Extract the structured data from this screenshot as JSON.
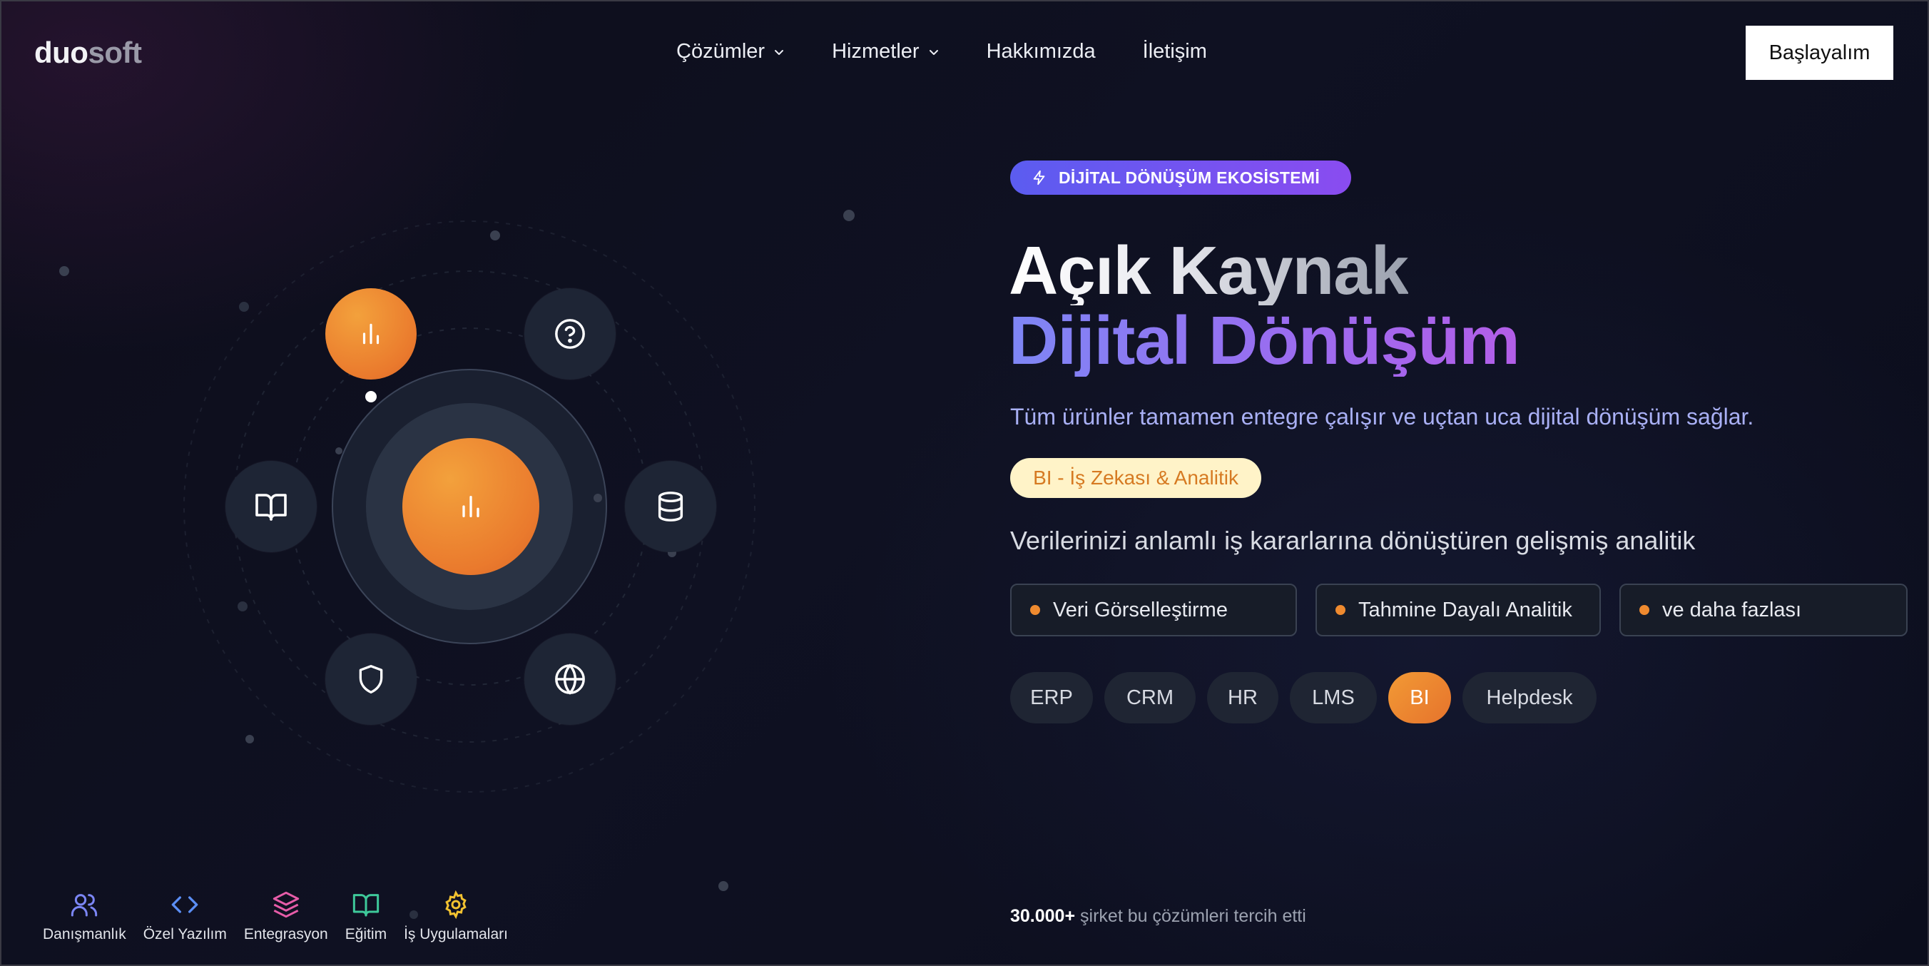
{
  "brand": {
    "logo_part1": "duo",
    "logo_part2": "soft"
  },
  "nav": {
    "items": [
      {
        "label": "Çözümler",
        "has_dropdown": true
      },
      {
        "label": "Hizmetler",
        "has_dropdown": true
      },
      {
        "label": "Hakkımızda",
        "has_dropdown": false
      },
      {
        "label": "İletişim",
        "has_dropdown": false
      }
    ],
    "cta_label": "Başlayalım"
  },
  "orbit": {
    "center_icon": "bar-chart-icon",
    "nodes": [
      "bar-chart-icon",
      "help-circle-icon",
      "book-icon",
      "database-icon",
      "shield-icon",
      "globe-icon"
    ],
    "active_node": "bar-chart-icon"
  },
  "hero": {
    "badge": "DİJİTAL DÖNÜŞÜM EKOSİSTEMİ",
    "title_line1": "Açık Kaynak",
    "title_line2": "Dijital Dönüşüm",
    "subtitle": "Tüm ürünler tamamen entegre çalışır ve uçtan uca dijital dönüşüm sağlar.",
    "product_pill": "BI - İş Zekası & Analitik",
    "description": "Verilerinizi anlamlı iş kararlarına dönüştüren gelişmiş analitik",
    "features": [
      "Veri Görselleştirme",
      "Tahmine Dayalı Analitik",
      "ve daha fazlası"
    ],
    "chips": [
      "ERP",
      "CRM",
      "HR",
      "LMS",
      "BI",
      "Helpdesk"
    ],
    "active_chip": "BI",
    "trust_count": "30.000+",
    "trust_text": "şirket bu çözümleri tercih etti"
  },
  "bottom_bar": [
    {
      "label": "Danışmanlık",
      "icon": "users-icon",
      "color": "#7b86f5"
    },
    {
      "label": "Özel Yazılım",
      "icon": "code-icon",
      "color": "#5b8ef5"
    },
    {
      "label": "Entegrasyon",
      "icon": "layers-icon",
      "color": "#e65ca8"
    },
    {
      "label": "Eğitim",
      "icon": "book-open-icon",
      "color": "#3ec99a"
    },
    {
      "label": "İş Uygulamaları",
      "icon": "gear-icon",
      "color": "#f2c230"
    }
  ],
  "colors": {
    "accent_orange": "#ea7a2d",
    "accent_purple": "#8a4cf0",
    "background": "#0f1122"
  }
}
